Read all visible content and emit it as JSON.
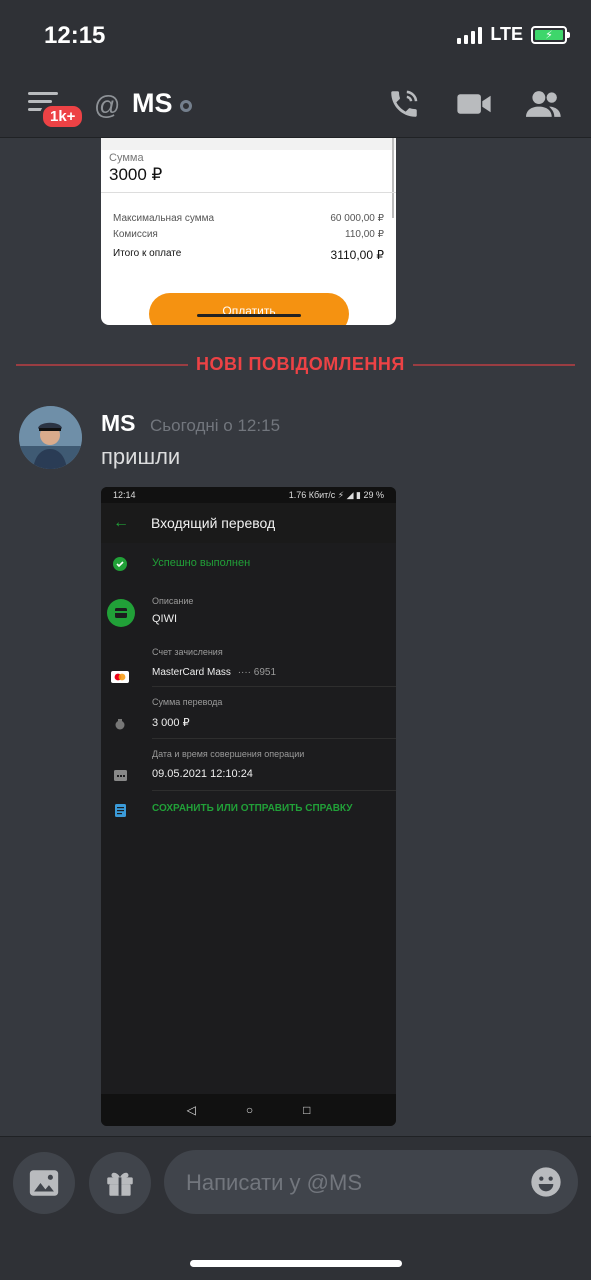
{
  "status_bar": {
    "time": "12:15",
    "network": "LTE"
  },
  "header": {
    "badge": "1k+",
    "at_symbol": "@",
    "channel": "MS"
  },
  "embed1": {
    "sum_label": "Сумма",
    "sum_value": "3000 ₽",
    "rows": [
      {
        "label": "Максимальная сумма",
        "value": "60 000,00 ₽"
      },
      {
        "label": "Комиссия",
        "value": "110,00 ₽"
      }
    ],
    "total_label": "Итого к оплате",
    "total_value": "3110,00 ₽",
    "pay_button": "Оплатить"
  },
  "divider": {
    "label": "НОВІ ПОВІДОМЛЕННЯ"
  },
  "message": {
    "author": "MS",
    "timestamp": "Сьогодні о 12:15",
    "text": "пришли"
  },
  "embed2": {
    "status_time": "12:14",
    "status_right": "1.76 Кбит/с ⚡ ◢ ▮ 29 %",
    "title": "Входящий перевод",
    "success": "Успешно выполнен",
    "desc_label": "Описание",
    "desc_value": "QIWI",
    "account_label": "Счет зачисления",
    "account_value": "MasterCard Mass",
    "account_mask": "···· 6951",
    "amount_label": "Сумма перевода",
    "amount_value": "3 000 ₽",
    "datetime_label": "Дата и время совершения операции",
    "datetime_value": "09.05.2021 12:10:24",
    "save_link": "СОХРАНИТЬ ИЛИ ОТПРАВИТЬ СПРАВКУ",
    "nav": [
      "◁",
      "○",
      "□"
    ]
  },
  "composer": {
    "placeholder": "Написати у @MS"
  },
  "colors": {
    "accent_red": "#ed4245",
    "sber_green": "#21a038",
    "pay_orange": "#f59211"
  }
}
